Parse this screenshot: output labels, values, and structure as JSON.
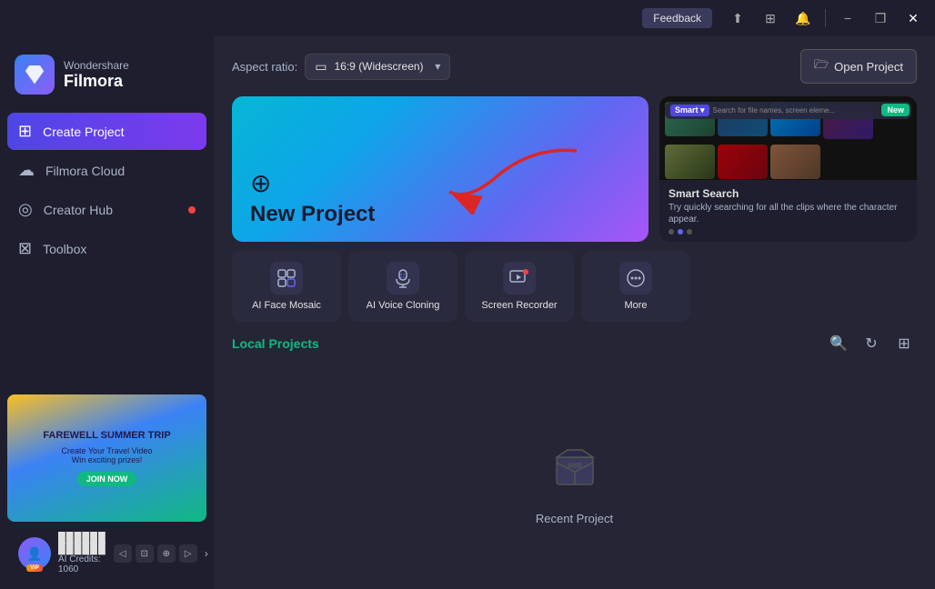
{
  "app": {
    "brand": "Wondershare",
    "product": "Filmora"
  },
  "titlebar": {
    "feedback_label": "Feedback",
    "minimize_label": "−",
    "restore_label": "❐",
    "close_label": "✕"
  },
  "sidebar": {
    "nav_items": [
      {
        "id": "create-project",
        "label": "Create Project",
        "icon": "⊞",
        "active": true
      },
      {
        "id": "filmora-cloud",
        "label": "Filmora Cloud",
        "icon": "☁",
        "active": false
      },
      {
        "id": "creator-hub",
        "label": "Creator Hub",
        "icon": "◎",
        "active": false,
        "dot": true
      },
      {
        "id": "toolbox",
        "label": "Toolbox",
        "icon": "⊠",
        "active": false
      }
    ],
    "promo": {
      "title": "FAREWELL SUMMER TRIP",
      "sub": "Create Your Travel Video\nWin exciting prizes!",
      "join": "JOIN NOW"
    },
    "user": {
      "name": "██████ ██████",
      "credits_label": "AI Credits: 1060",
      "vip": "VIP"
    }
  },
  "topbar": {
    "aspect_label": "Aspect ratio:",
    "aspect_icon": "▭",
    "aspect_value": "16:9 (Widescreen)",
    "open_project_label": "Open Project",
    "folder_icon": "🗁"
  },
  "new_project": {
    "icon": "⊕",
    "label": "New Project"
  },
  "smart_search": {
    "badge": "New",
    "search_placeholder": "Search for file names, screen eleme...",
    "title": "Smart Search",
    "description": "Try quickly searching for all the clips where the character appear.",
    "dots": [
      false,
      true,
      false
    ]
  },
  "tools": [
    {
      "id": "ai-face-mosaic",
      "label": "AI Face Mosaic",
      "icon": "⊞"
    },
    {
      "id": "ai-voice-cloning",
      "label": "AI Voice Cloning",
      "icon": "🎤"
    },
    {
      "id": "screen-recorder",
      "label": "Screen Recorder",
      "icon": "⊡"
    },
    {
      "id": "more",
      "label": "More",
      "icon": "⊕"
    }
  ],
  "local_projects": {
    "title": "Local Projects",
    "empty_label": "Recent Project",
    "search_icon": "🔍",
    "refresh_icon": "↻",
    "grid_icon": "⊞"
  }
}
